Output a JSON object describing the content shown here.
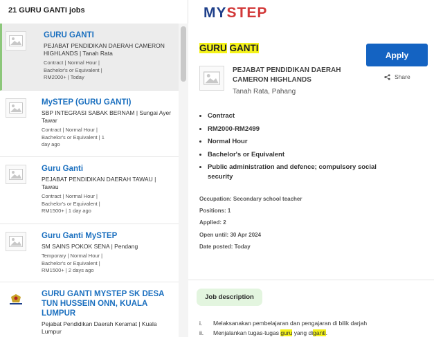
{
  "left": {
    "header": "21 GURU GANTI jobs",
    "jobs": [
      {
        "title": "GURU GANTI",
        "company": "PEJABAT PENDIDIKAN DAERAH CAMERON HIGHLANDS  |  Tanah Rata",
        "meta1": "Contract    |    Normal Hour    |",
        "meta2": "Bachelor's or Equivalent    |",
        "meta3": "RM2000+    |    Today"
      },
      {
        "title": "MySTEP (GURU GANTI)",
        "company": "SBP INTEGRASI SABAK BERNAM  |  Sungai Ayer Tawar",
        "meta1": "Contract    |    Normal Hour    |",
        "meta2": "Bachelor's or Equivalent    |    1",
        "meta3": "day ago"
      },
      {
        "title": "Guru Ganti",
        "company": "PEJABAT PENDIDIKAN DAERAH TAWAU  |  Tawau",
        "meta1": "Contract    |    Normal Hour    |",
        "meta2": "Bachelor's or Equivalent    |",
        "meta3": "RM1500+    |    1 day ago"
      },
      {
        "title": "Guru Ganti MySTEP",
        "company": "SM SAINS POKOK SENA  |  Pendang",
        "meta1": "Temporary    |    Normal Hour    |",
        "meta2": "Bachelor's or Equivalent    |",
        "meta3": "RM1500+    |    2 days ago"
      },
      {
        "title": "GURU GANTI MYSTEP SK DESA TUN HUSSEIN ONN, KUALA LUMPUR",
        "company": "Pejabat Pendidikan Daerah Keramat  |  Kuala Lumpur",
        "meta1": "",
        "meta2": "",
        "meta3": ""
      }
    ]
  },
  "right": {
    "brand_a": "MY",
    "brand_b": "STEP",
    "title_word1": "GURU",
    "title_word2": "GANTI",
    "apply_label": "Apply",
    "share_label": "Share",
    "company_name": "PEJABAT PENDIDIKAN DAERAH CAMERON HIGHLANDS",
    "company_location": "Tanah Rata, Pahang",
    "bullets": [
      "Contract",
      "RM2000-RM2499",
      "Normal Hour",
      "Bachelor's or Equivalent",
      "Public administration and defence; compulsory social security"
    ],
    "details": [
      "Occupation: Secondary school teacher",
      "Positions: 1",
      "Applied: 2",
      "Open until: 30 Apr 2024",
      "Date posted: Today"
    ],
    "jd_label": "Job description",
    "jd_items": [
      {
        "num": "i.",
        "text": "Melaksanakan pembelajaran dan pengajaran di bilik darjah"
      },
      {
        "num": "ii.",
        "pre": "Menjalankan tugas-tugas ",
        "hl1": "guru",
        "mid": " yang di",
        "hl2": "ganti",
        "post": "."
      }
    ]
  },
  "colors": {
    "accent_blue": "#1463c2",
    "link_blue": "#1a6fbf",
    "active_bar": "#8cc77a",
    "highlight": "#f5f31a",
    "jd_bg": "#e3f5df"
  }
}
